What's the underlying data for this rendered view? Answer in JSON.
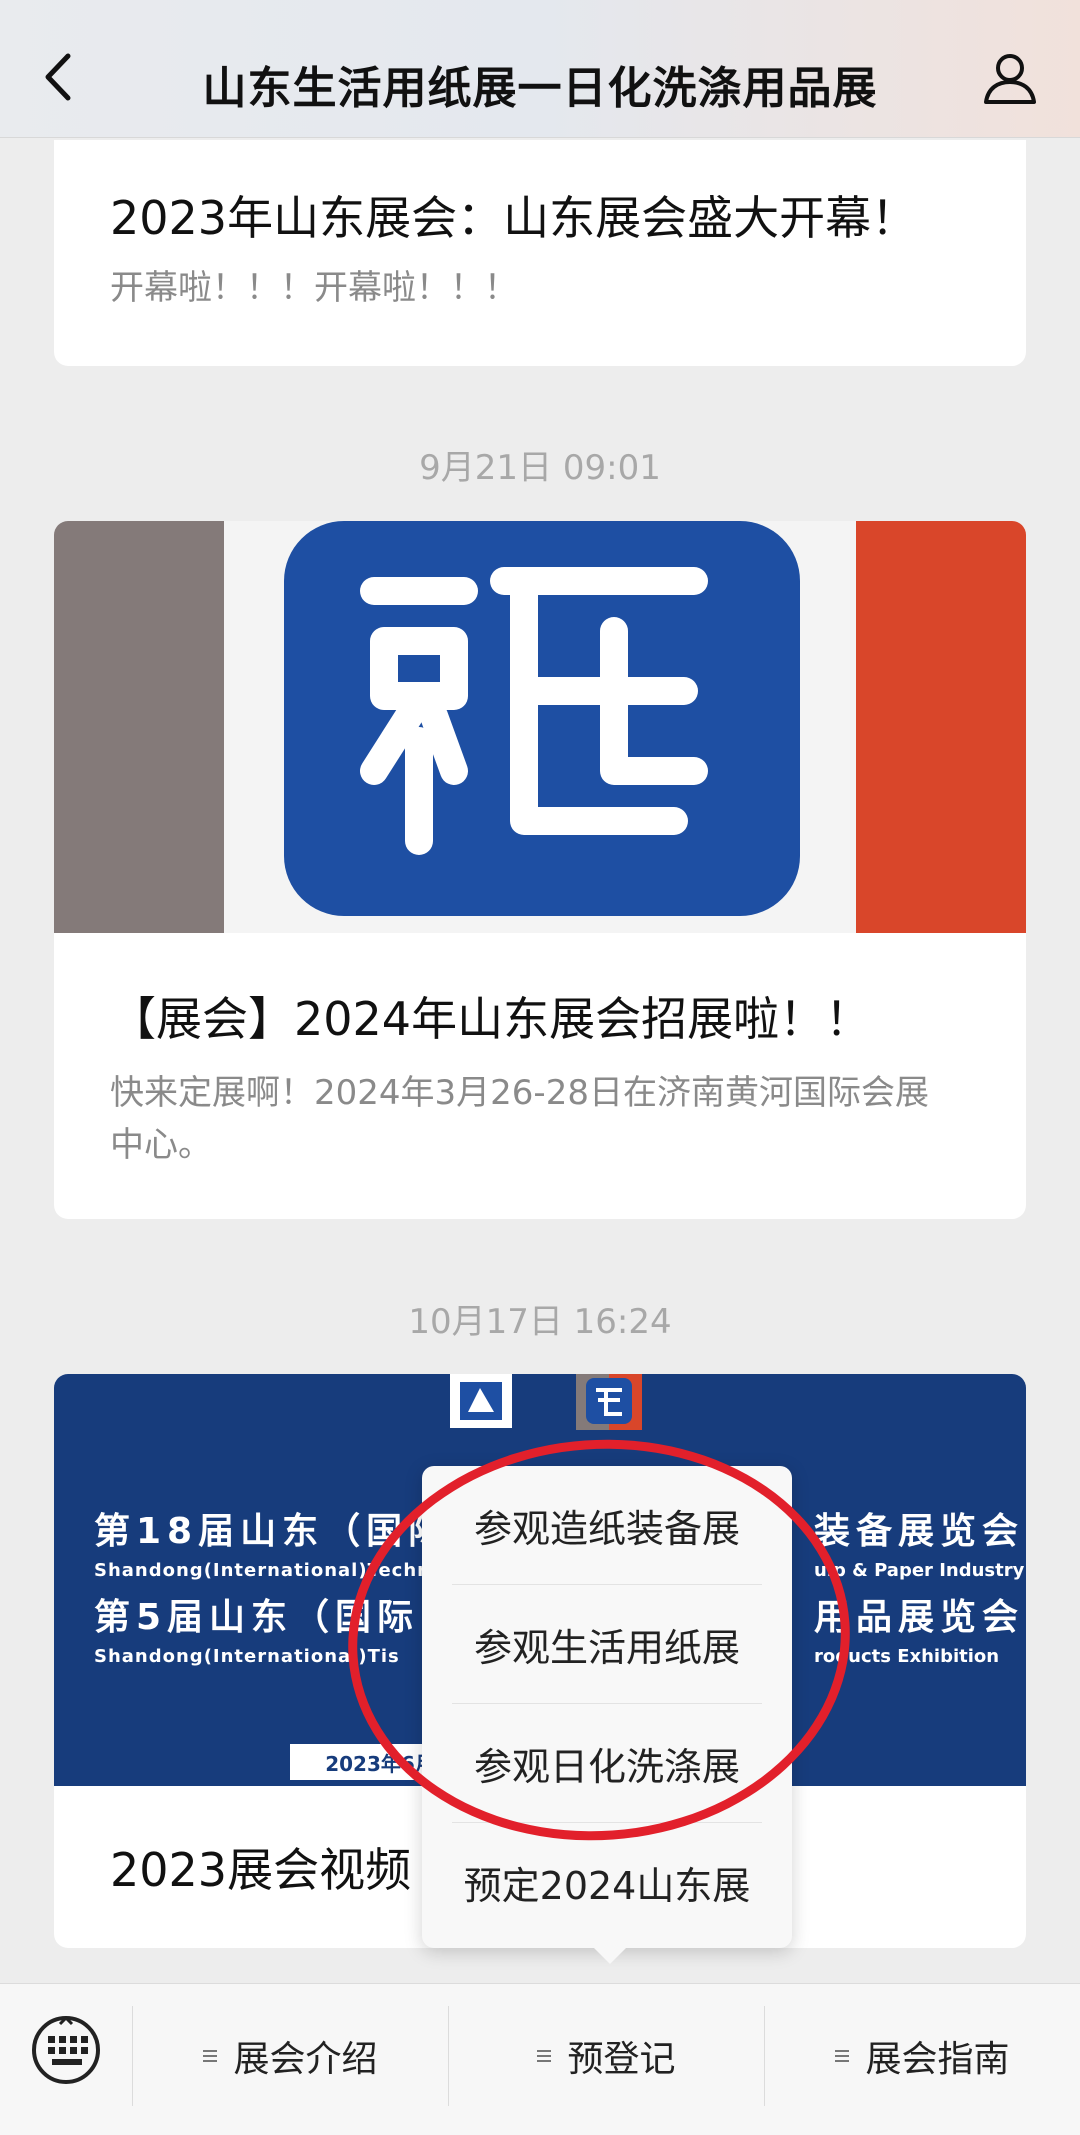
{
  "header": {
    "title": "山东生活用纸展一日化洗涤用品展"
  },
  "card1": {
    "title": "2023年山东展会：山东展会盛大开幕！",
    "desc": "开幕啦！！！开幕啦！！！"
  },
  "time1": "9月21日 09:01",
  "card2": {
    "title": "【展会】2024年山东展会招展啦！！",
    "desc": "快来定展啊！2024年3月26-28日在济南黄河国际会展中心。"
  },
  "time2": "10月17日 16:24",
  "card3": {
    "title": "2023展会视频",
    "poster": {
      "line1": "第18届山东（国际",
      "line1b": "装备展览会",
      "line1en": "Shandong(International)Techni",
      "line1enb": "ulp & Paper Industry",
      "line2": "第5届山东（国际",
      "line2b": "用品展览会",
      "line2en": "Shandong(International)Tis",
      "line2enb": "roducts Exhibition",
      "badge": "2023年6月"
    }
  },
  "popup": {
    "items": [
      "参观造纸装备展",
      "参观生活用纸展",
      "参观日化洗涤展",
      "预定2024山东展"
    ]
  },
  "bottom_menu": {
    "items": [
      "展会介绍",
      "预登记",
      "展会指南"
    ]
  },
  "colors": {
    "accent_red": "#e2202b",
    "logo_blue": "#1e4fa3",
    "poster_blue": "#173c7c"
  }
}
